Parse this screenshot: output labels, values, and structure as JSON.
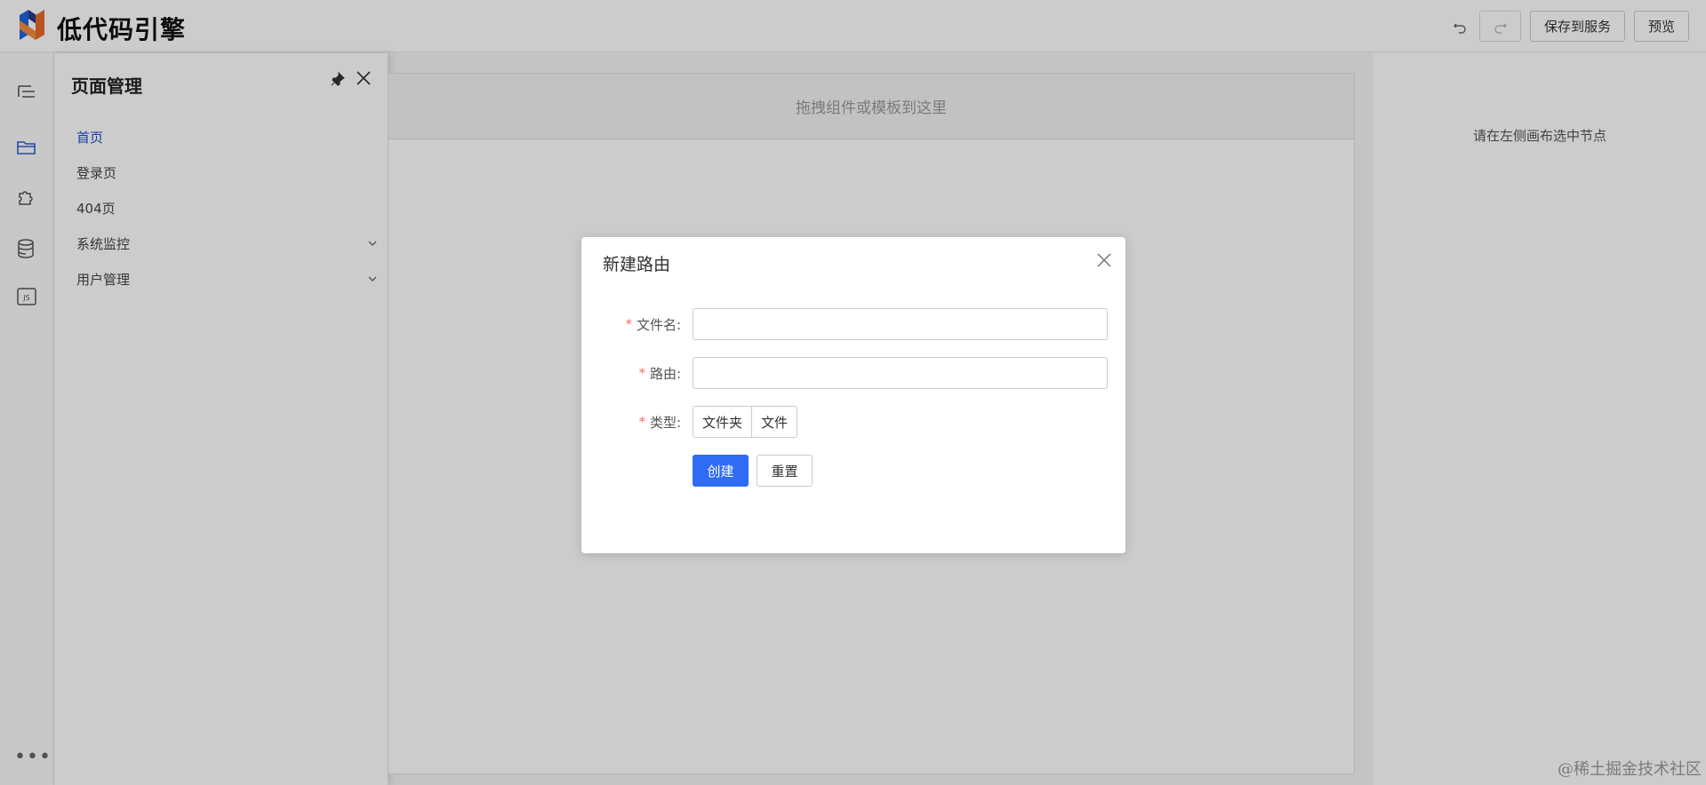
{
  "header": {
    "brand": "低代码引擎",
    "save_label": "保存到服务",
    "preview_label": "预览"
  },
  "rail": {
    "icons": [
      "outline-icon",
      "folder-icon",
      "puzzle-icon",
      "database-icon",
      "js-icon"
    ],
    "more_label": "•••"
  },
  "panel": {
    "title": "页面管理",
    "items": [
      {
        "label": "首页",
        "active": true
      },
      {
        "label": "登录页"
      },
      {
        "label": "404页"
      },
      {
        "label": "系统监控",
        "expandable": true
      },
      {
        "label": "用户管理",
        "expandable": true
      }
    ]
  },
  "canvas": {
    "dropzone_text": "拖拽组件或模板到这里"
  },
  "right_panel": {
    "hint": "请在左侧画布选中节点"
  },
  "dialog": {
    "title": "新建路由",
    "fields": {
      "filename_label": "文件名:",
      "filename_value": "",
      "route_label": "路由:",
      "route_value": "",
      "type_label": "类型:"
    },
    "type_options": [
      "文件夹",
      "文件"
    ],
    "required_mark": "*",
    "create_label": "创建",
    "reset_label": "重置"
  },
  "watermark": "@稀土掘金技术社区",
  "colors": {
    "accent": "#2f6bf5",
    "active_item": "#1f4bd6",
    "required": "#f56c6c"
  }
}
